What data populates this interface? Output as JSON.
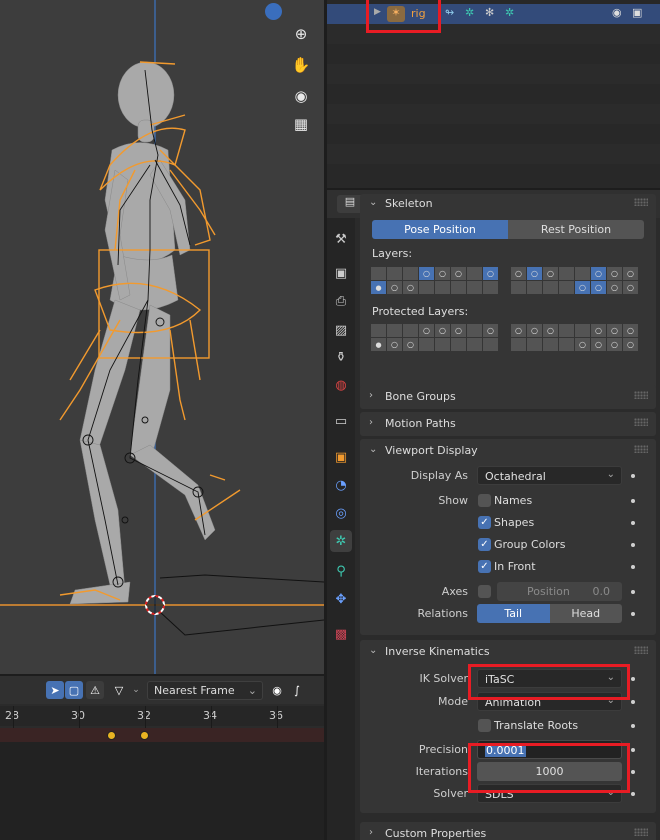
{
  "outliner": {
    "rig_label": "rig"
  },
  "timeline": {
    "snap_mode": "Nearest Frame",
    "ticks": [
      "28",
      "30",
      "32",
      "34",
      "36"
    ]
  },
  "properties": {
    "skeleton": {
      "title": "Skeleton",
      "pose_position": "Pose Position",
      "rest_position": "Rest Position",
      "layers_label": "Layers:",
      "protected_layers_label": "Protected Layers:"
    },
    "panels": {
      "bone_groups": "Bone Groups",
      "motion_paths": "Motion Paths",
      "viewport_display": "Viewport Display",
      "inverse_kinematics": "Inverse Kinematics",
      "custom_properties": "Custom Properties"
    },
    "viewport_display": {
      "display_as_label": "Display As",
      "display_as_value": "Octahedral",
      "show_label": "Show",
      "names": "Names",
      "shapes": "Shapes",
      "group_colors": "Group Colors",
      "in_front": "In Front",
      "axes_label": "Axes",
      "position_label": "Position",
      "position_value": "0.0",
      "relations_label": "Relations",
      "tail": "Tail",
      "head": "Head"
    },
    "ik": {
      "ik_solver_label": "IK Solver",
      "ik_solver_value": "iTaSC",
      "mode_label": "Mode",
      "mode_value": "Animation",
      "translate_roots": "Translate Roots",
      "precision_label": "Precision",
      "precision_value": "0.0001",
      "iterations_label": "Iterations",
      "iterations_value": "1000",
      "solver_label": "Solver",
      "solver_value": "SDLS"
    }
  },
  "colors": {
    "accent": "#4772b3",
    "highlight": "#e81c24",
    "bone": "#f29a2e"
  }
}
